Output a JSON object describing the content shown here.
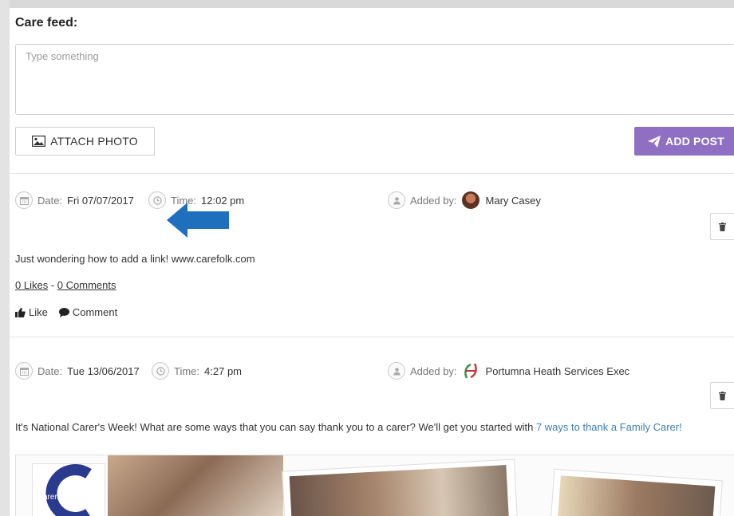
{
  "feed": {
    "title": "Care feed:",
    "composer_placeholder": "Type something",
    "attach_label": "ATTACH PHOTO",
    "add_label": "ADD POST"
  },
  "posts": [
    {
      "date_label": "Date:",
      "date": "Fri 07/07/2017",
      "time_label": "Time:",
      "time": "12:02 pm",
      "added_label": "Added by:",
      "author": "Mary Casey",
      "text": "Just wondering how to add a link! www.carefolk.com",
      "likes": "0 Likes",
      "separator": "-",
      "comments": "0 Comments",
      "like_action": "Like",
      "comment_action": "Comment"
    },
    {
      "date_label": "Date:",
      "date": "Tue 13/06/2017",
      "time_label": "Time:",
      "time": "4:27 pm",
      "added_label": "Added by:",
      "author": "Portumna Heath Services Exec",
      "text": "It's National Carer's Week! What are some ways that you can say thank you to a carer? We'll get you started with ",
      "link_text": "7 ways to thank a Family Carer!",
      "photo_logo_text": "carers week"
    }
  ],
  "colors": {
    "accent": "#8e6fc4",
    "link": "#3e7fb0",
    "annotation_arrow": "#1f6fbf"
  }
}
